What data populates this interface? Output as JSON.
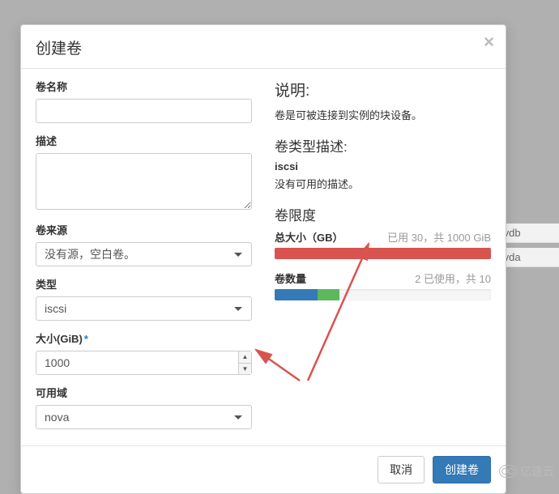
{
  "modal": {
    "title": "创建卷",
    "close_aria": "Close"
  },
  "form": {
    "name_label": "卷名称",
    "name_value": "",
    "desc_label": "描述",
    "desc_value": "",
    "source_label": "卷来源",
    "source_value": "没有源，空白卷。",
    "type_label": "类型",
    "type_value": "iscsi",
    "size_label": "大小(GiB)",
    "size_required_mark": "*",
    "size_value": "1000",
    "az_label": "可用域",
    "az_value": "nova"
  },
  "help": {
    "explain_heading": "说明:",
    "explain_text": "卷是可被连接到实例的块设备。",
    "typedesc_heading": "卷类型描述:",
    "typedesc_name": "iscsi",
    "typedesc_text": "没有可用的描述。",
    "limits_heading": "卷限度"
  },
  "quota": {
    "size": {
      "label": "总大小（GB）",
      "text": "已用 30，共 1000 GiB",
      "bar_pct": 100,
      "bar_color": "red"
    },
    "count": {
      "label": "卷数量",
      "text": "2 已使用，共 10",
      "used_pct": 20,
      "proposed_pct": 10
    }
  },
  "footer": {
    "cancel": "取消",
    "submit": "创建卷"
  },
  "background": {
    "row1": "/vdb",
    "row2": "/vda"
  },
  "watermark": "亿速云"
}
